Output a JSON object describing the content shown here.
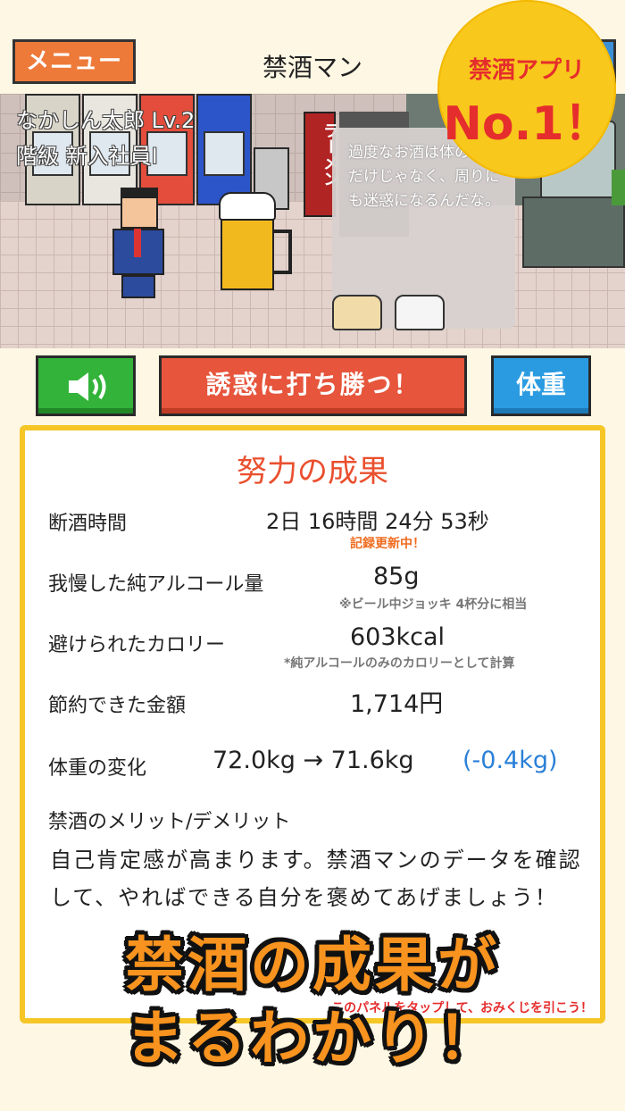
{
  "header": {
    "menu_label": "メニュー",
    "title": "禁酒マン"
  },
  "badge": {
    "top": "禁酒アプリ",
    "main": "No.1！"
  },
  "scene": {
    "player_name": "なかしん太郎 Lv.2",
    "player_rank": "階級 新入社員Ⅰ",
    "speech": "過度なお酒は体の健康だけじゃなく、周りにも迷惑になるんだな。",
    "sign_text": "ラーメン"
  },
  "actions": {
    "sound_icon": "speaker-icon",
    "tempt_label": "誘惑に打ち勝つ！",
    "weight_label": "体重"
  },
  "panel": {
    "title": "努力の成果",
    "rows": {
      "abstain_label": "断酒時間",
      "abstain_value": "2日 16時間 24分 53秒",
      "abstain_note": "記録更新中！",
      "alcohol_label": "我慢した純アルコール量",
      "alcohol_value": "85g",
      "alcohol_note": "※ビール中ジョッキ 4杯分に相当",
      "calorie_label": "避けられたカロリー",
      "calorie_value": "603kcal",
      "calorie_note": "*純アルコールのみのカロリーとして計算",
      "money_label": "節約できた金額",
      "money_value": "1,714円",
      "weight_label": "体重の変化",
      "weight_value": "72.0kg → 71.6kg",
      "weight_diff": "(-0.4kg)"
    },
    "merit_title": "禁酒のメリット/デメリット",
    "merit_text": "自己肯定感が高まります。禁酒マンのデータを確認して、やればできる自分を褒めてあげましょう！",
    "hint": "このパネルをタップして、おみくじを引こう！"
  },
  "promo": {
    "line1": "禁酒の成果が",
    "line2": "まるわかり！"
  },
  "colors": {
    "background": "#fdf7e3",
    "menu": "#ee7a3a",
    "tempt": "#e6553c",
    "sound": "#33b33a",
    "weight": "#2a9be0",
    "badge": "#f8c81c",
    "panel_border": "#f5c626",
    "title": "#ea4f2e",
    "diff": "#2a80d8"
  }
}
